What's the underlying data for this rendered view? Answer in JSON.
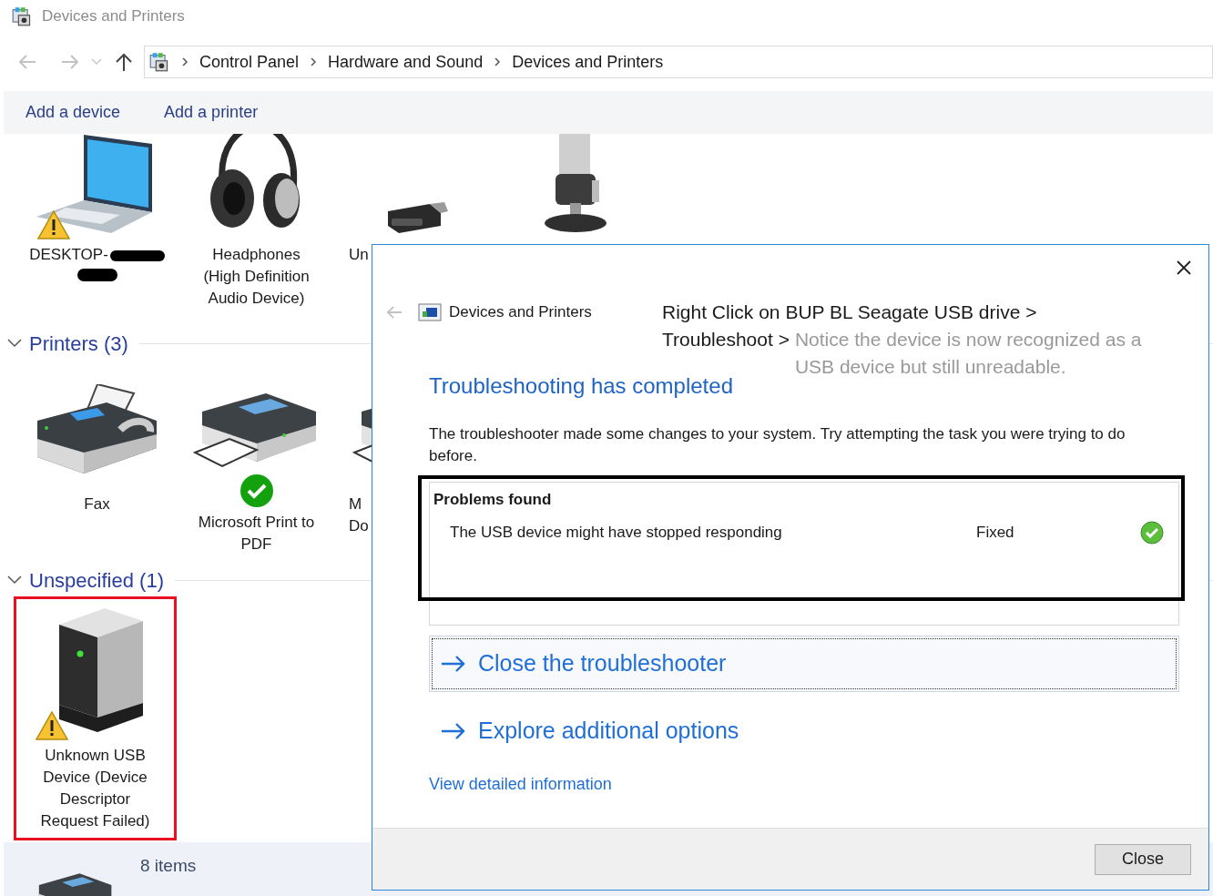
{
  "window": {
    "title": "Devices and Printers"
  },
  "breadcrumb": [
    "Control Panel",
    "Hardware and Sound",
    "Devices and Printers"
  ],
  "toolbar": [
    "Add a device",
    "Add a printer"
  ],
  "devices": [
    {
      "kind": "laptop",
      "lines": [
        "DESKTOP-"
      ],
      "warning": true,
      "redacted": true
    },
    {
      "kind": "headphones",
      "lines": [
        "Headphones",
        "(High Definition",
        "Audio Device)"
      ],
      "warning": false
    },
    {
      "kind": "receiver",
      "lines": [
        "Un"
      ],
      "warning": false,
      "clipped": true
    },
    {
      "kind": "microphone",
      "warning": false
    }
  ],
  "groups": [
    {
      "title": "Printers (3)",
      "expanded": true,
      "devices": [
        {
          "kind": "fax",
          "lines": [
            "Fax"
          ],
          "warning": false,
          "default": false
        },
        {
          "kind": "printer",
          "lines": [
            "Microsoft Print to",
            "PDF"
          ],
          "warning": false,
          "default": true
        },
        {
          "kind": "printer",
          "lines": [
            "M",
            "Do"
          ],
          "warning": false,
          "clipped": true
        }
      ]
    },
    {
      "title": "Unspecified (1)",
      "expanded": true,
      "devices": [
        {
          "kind": "drive",
          "lines": [
            "Unknown USB",
            "Device (Device",
            "Descriptor",
            "Request Failed)"
          ],
          "warning": true,
          "highlighted": true
        }
      ]
    }
  ],
  "status_bar": {
    "count": "8 items"
  },
  "dialog": {
    "title": "Devices and Printers",
    "heading": "Troubleshooting has completed",
    "message": "The troubleshooter made some changes to your system. Try attempting the task you were trying to do before.",
    "problems": {
      "title": "Problems found",
      "rows": [
        {
          "problem": "The USB device might have stopped responding",
          "status": "Fixed",
          "fixed": true
        }
      ]
    },
    "actions": [
      {
        "label": "Close the troubleshooter",
        "focused": true
      },
      {
        "label": "Explore additional options",
        "focused": false
      }
    ],
    "details_link": "View detailed information",
    "button": "Close"
  },
  "annotation": {
    "step_1": "Right Click on BUP BL Seagate USB drive >",
    "step_2": "Troubleshoot >",
    "note": "Notice the device is now recognized as a USB device but still unreadable."
  }
}
